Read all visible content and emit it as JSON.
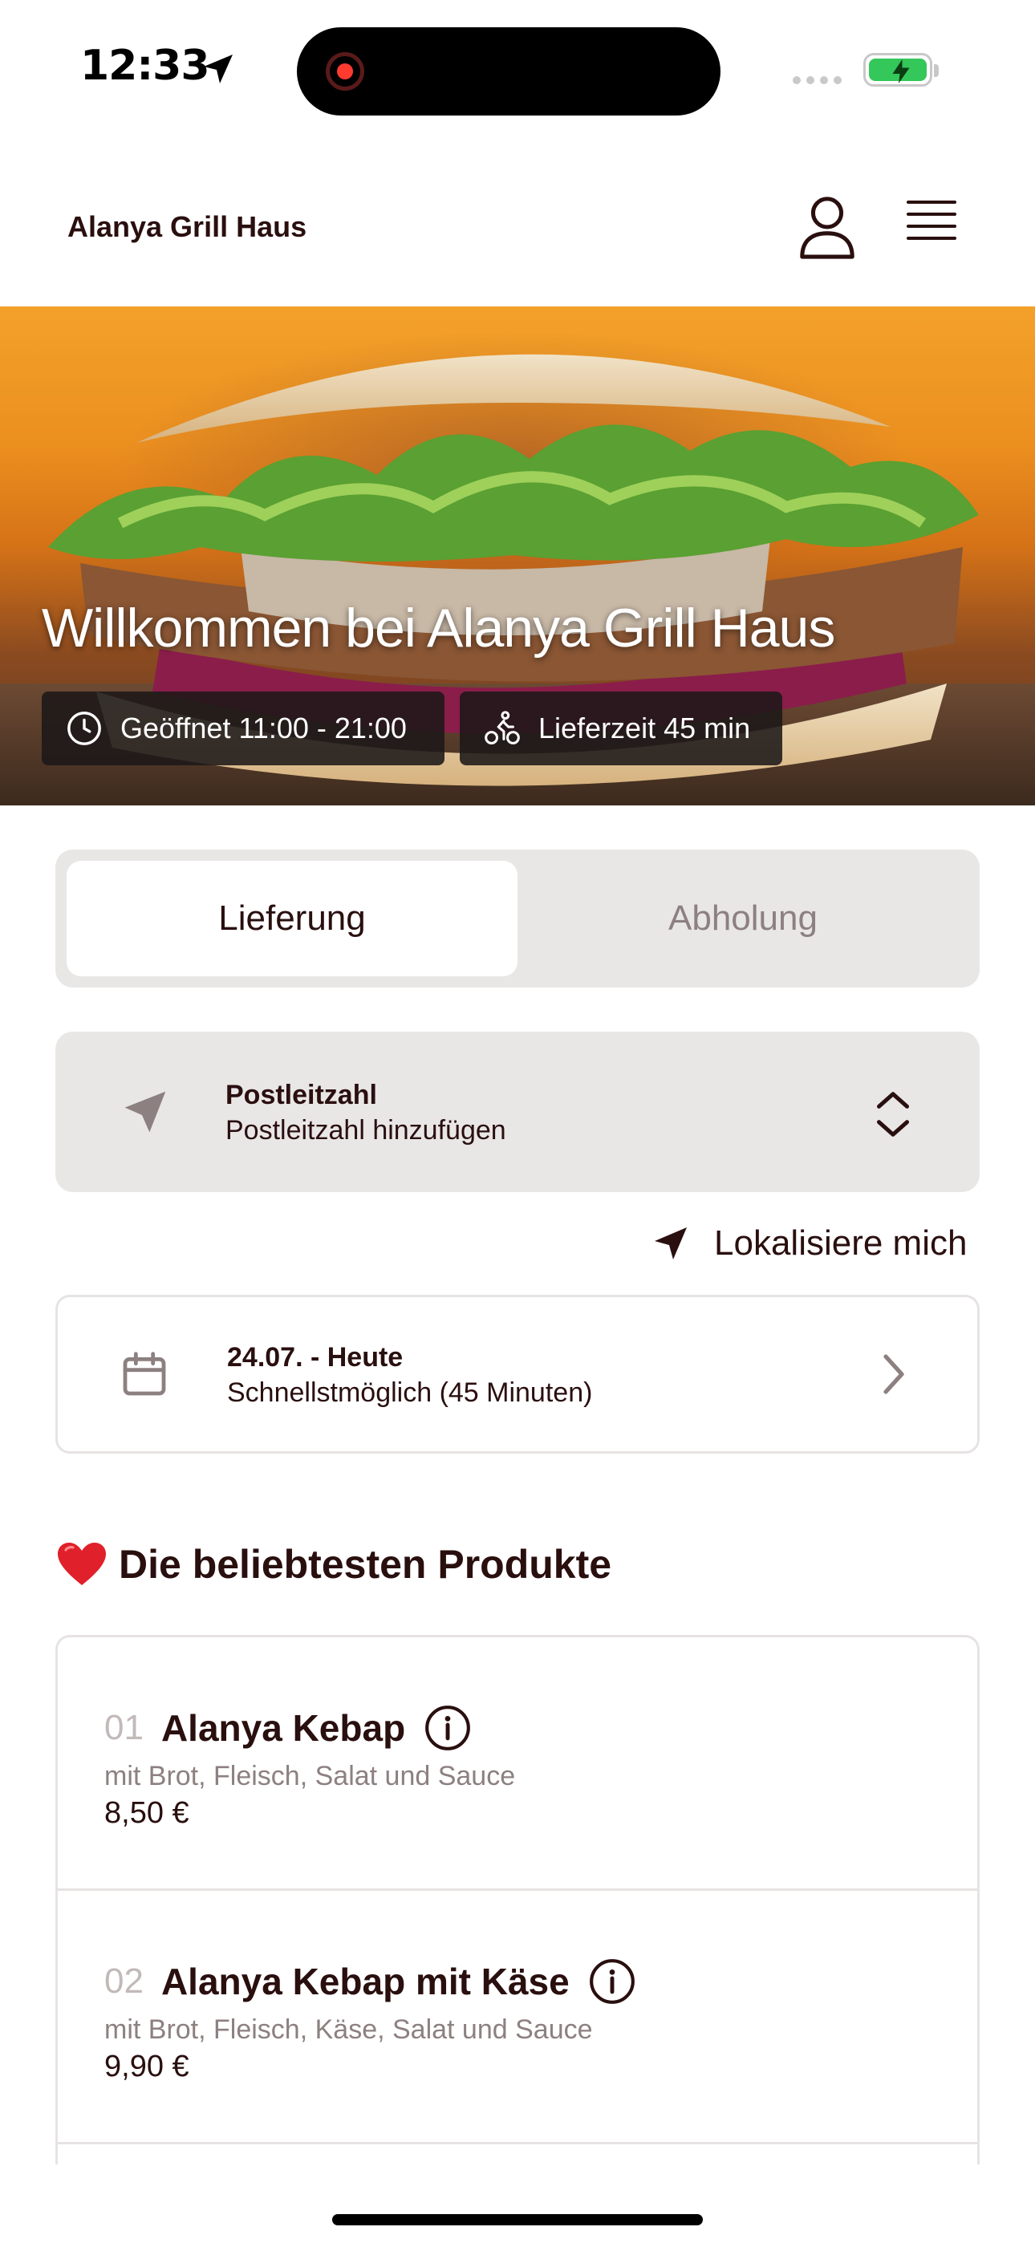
{
  "status_bar": {
    "time": "12:33"
  },
  "header": {
    "title": "Alanya Grill Haus",
    "account_icon": "person-icon",
    "menu_icon": "hamburger-menu-icon"
  },
  "hero": {
    "title": "Willkommen bei Alanya Grill Haus",
    "opening_hours": "Geöffnet 11:00 - 21:00",
    "delivery_time": "Lieferzeit 45 min"
  },
  "mode_tabs": {
    "active": "Lieferung",
    "inactive": "Abholung"
  },
  "postcode": {
    "label": "Postleitzahl",
    "placeholder": "Postleitzahl hinzufügen"
  },
  "locate": {
    "label": "Lokalisiere mich"
  },
  "date": {
    "title": "24.07. - Heute",
    "subtitle": "Schnellstmöglich (45 Minuten)"
  },
  "popular": {
    "heading": "Die beliebtesten Produkte",
    "items": [
      {
        "number": "01",
        "name": "Alanya Kebap",
        "description": "mit Brot, Fleisch, Salat und Sauce",
        "price": "8,50 €"
      },
      {
        "number": "02",
        "name": "Alanya Kebap mit Käse",
        "description": "mit Brot, Fleisch, Käse, Salat und Sauce",
        "price": "9,90 €"
      }
    ]
  },
  "colors": {
    "text_primary": "#2a0f0f",
    "text_muted": "#8d8080",
    "panel_bg": "#e9e6e6",
    "border": "#e7e3e3",
    "battery_green": "#34c759"
  }
}
